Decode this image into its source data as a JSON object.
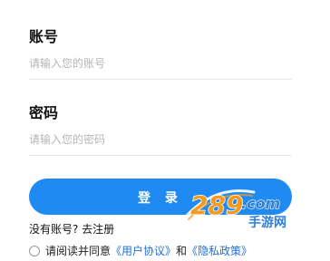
{
  "form": {
    "account_label": "账号",
    "account_placeholder": "请输入您的账号",
    "password_label": "密码",
    "password_placeholder": "请输入您的密码",
    "login_button": "登 录",
    "register_link": "没有账号? 去注册",
    "agreement_prefix": "请阅读并同意",
    "user_agreement": "《用户协议》",
    "agreement_and": "和",
    "privacy_policy": "《隐私政策》"
  },
  "watermark": {
    "text_main": "289",
    "text_suffix": ".com",
    "text_sub": "手游网"
  },
  "colors": {
    "primary": "#1f8bf2",
    "link": "#1f6fd6",
    "watermark_orange": "#f39a21",
    "watermark_blue": "#2f7fd8"
  }
}
